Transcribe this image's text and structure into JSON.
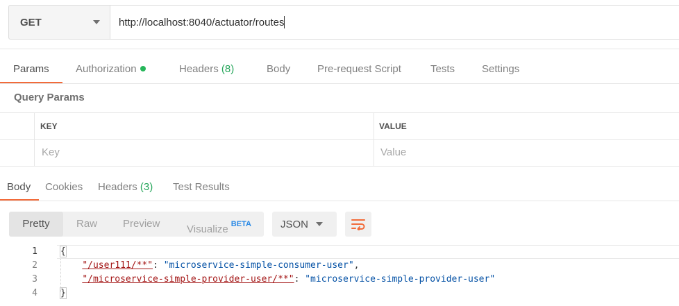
{
  "request": {
    "method": "GET",
    "url": "http://localhost:8040/actuator/routes"
  },
  "request_tabs": {
    "params": "Params",
    "authorization": "Authorization",
    "headers": "Headers",
    "headers_count": "(8)",
    "body": "Body",
    "prerequest": "Pre-request Script",
    "tests": "Tests",
    "settings": "Settings"
  },
  "query_params": {
    "title": "Query Params",
    "col_key": "KEY",
    "col_value": "VALUE",
    "key_placeholder": "Key",
    "value_placeholder": "Value"
  },
  "response_tabs": {
    "body": "Body",
    "cookies": "Cookies",
    "headers": "Headers",
    "headers_count": "(3)",
    "test_results": "Test Results"
  },
  "view_modes": {
    "pretty": "Pretty",
    "raw": "Raw",
    "preview": "Preview",
    "visualize": "Visualize",
    "beta": "BETA"
  },
  "format": {
    "selected": "JSON"
  },
  "code": {
    "line_numbers": [
      "1",
      "2",
      "3",
      "4"
    ],
    "open_brace": "{",
    "close_brace": "}",
    "entries": [
      {
        "key": "\"/user111/**\"",
        "value": "\"microservice-simple-consumer-user\"",
        "sep": ": ",
        "trail": ","
      },
      {
        "key": "\"/microservice-simple-provider-user/**\"",
        "value": "\"microservice-simple-provider-user\"",
        "sep": ": ",
        "trail": ""
      }
    ]
  },
  "colors": {
    "accent": "#f26b3a",
    "count_green": "#26a65b",
    "beta_blue": "#2b8ae6",
    "json_key": "#a31515",
    "json_string": "#0451a5"
  },
  "icons": {
    "method_dropdown": "chevron-down-icon",
    "format_dropdown": "chevron-down-icon",
    "wrap": "wrap-lines-icon",
    "auth_status": "status-dot-icon"
  }
}
